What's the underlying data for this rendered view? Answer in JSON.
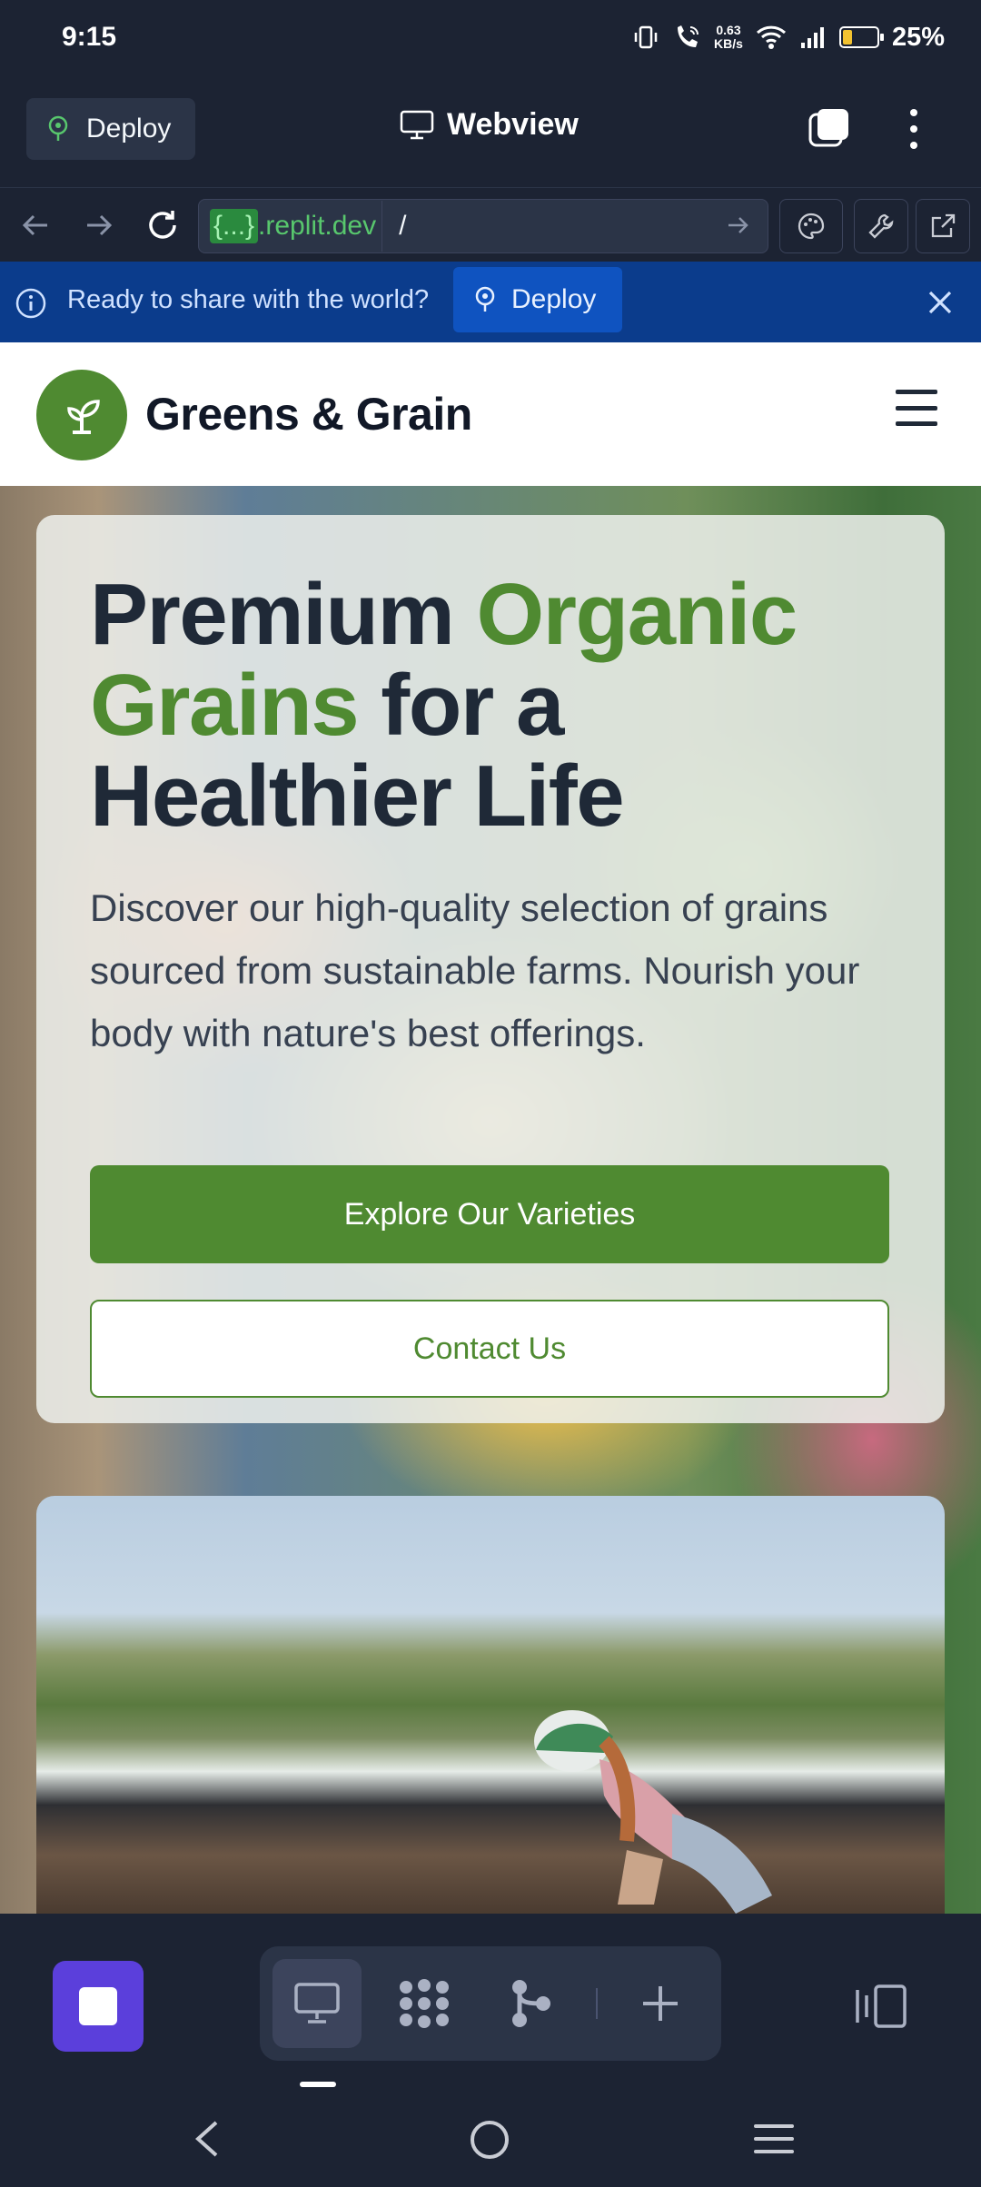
{
  "status_bar": {
    "time": "9:15",
    "net_speed_value": "0.63",
    "net_speed_unit": "KB/s",
    "battery_text": "25%",
    "battery_level": 0.25
  },
  "top_bar": {
    "deploy_label": "Deploy",
    "title": "Webview"
  },
  "url_bar": {
    "braces": "{...}",
    "domain": ".replit.dev",
    "path": "/"
  },
  "deploy_banner": {
    "message": "Ready to share with the world?",
    "button_label": "Deploy"
  },
  "site": {
    "brand": "Greens & Grain",
    "hero": {
      "title_part1": "Premium ",
      "title_accent": "Organic Grains",
      "title_part2": " for a Healthier Life",
      "subtitle": "Discover our high-quality selection of grains sourced from sustainable farms. Nourish your body with nature's best offerings.",
      "primary_button": "Explore Our Varieties",
      "secondary_button": "Contact Us"
    }
  },
  "colors": {
    "brand_green": "#4f8a31",
    "banner_blue": "#0b3c8c",
    "stop_purple": "#5b3fdb",
    "app_bg": "#1c2333"
  }
}
